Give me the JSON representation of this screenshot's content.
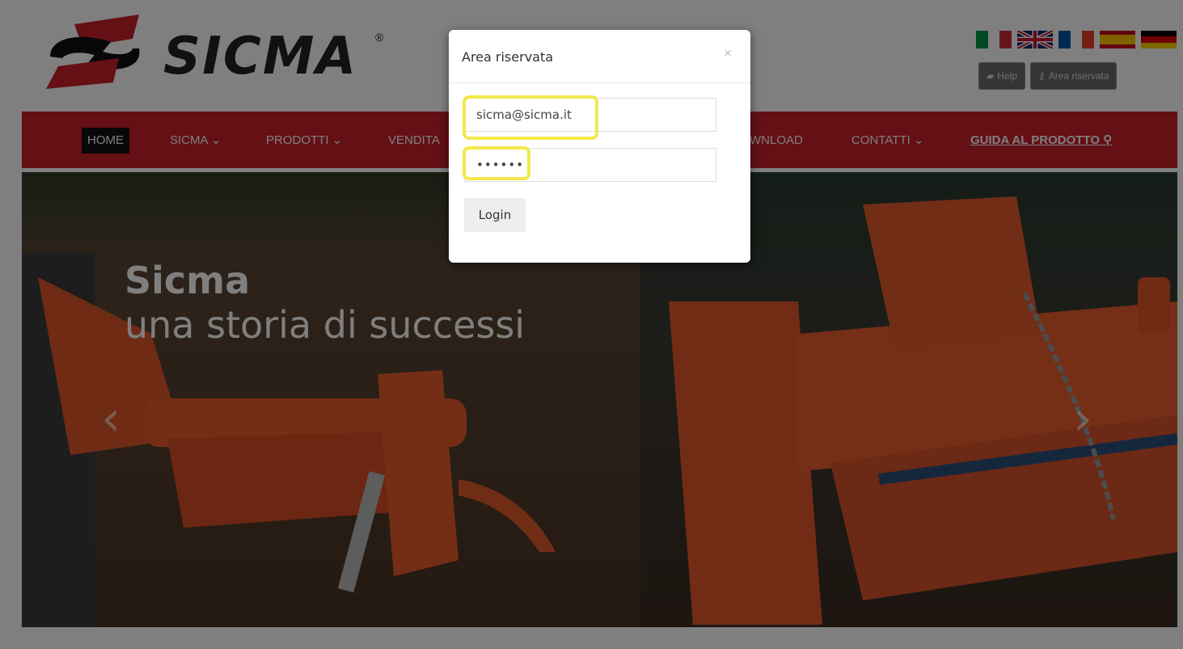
{
  "brand": {
    "name": "SICMA",
    "reg": "®"
  },
  "languages": [
    {
      "code": "it",
      "colors": [
        "#009246",
        "#ffffff",
        "#ce2b37"
      ]
    },
    {
      "code": "en",
      "colors": [
        "#012169",
        "#ffffff",
        "#c8102e"
      ]
    },
    {
      "code": "fr",
      "colors": [
        "#0055a4",
        "#ffffff",
        "#ef4135"
      ]
    },
    {
      "code": "es",
      "colors": [
        "#c60b1e",
        "#ffc400",
        "#c60b1e"
      ]
    },
    {
      "code": "de",
      "colors": [
        "#000000",
        "#dd0000",
        "#ffce00"
      ]
    }
  ],
  "top_buttons": {
    "help": "Help",
    "reserved": "Area riservata"
  },
  "nav": {
    "home": "HOME",
    "sicma": "SICMA ⌄",
    "prodotti": "PRODOTTI ⌄",
    "vendita": "VENDITA",
    "download": "WNLOAD",
    "contatti": "CONTATTI ⌄",
    "guida": "GUIDA AL PRODOTTO"
  },
  "hero": {
    "title": "Sicma",
    "subtitle": "una storia di successi"
  },
  "modal": {
    "title": "Area riservata",
    "close": "×",
    "email_value": "sicma@sicma.it",
    "password_value": "••••••",
    "login": "Login"
  },
  "colors": {
    "nav_red": "#c8202a",
    "highlight": "#f2e84a"
  }
}
